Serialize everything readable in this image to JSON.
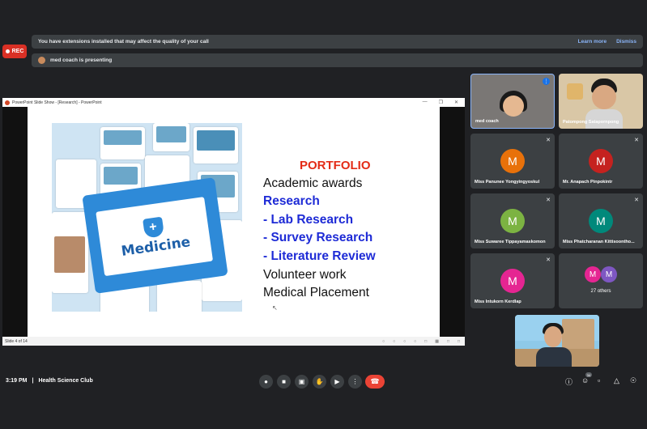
{
  "rec_label": "REC",
  "banner_extensions": {
    "text": "You have extensions installed that may affect the quality of your call",
    "learn_more": "Learn more",
    "dismiss": "Dismiss"
  },
  "banner_presenting": {
    "text": "med coach is presenting"
  },
  "ppt": {
    "title": "PowerPoint Slide Show - [Research] - PowerPoint",
    "status": "Slide 4 of 14",
    "slide": {
      "heading": "PORTFOLIO",
      "lines": [
        {
          "text": "Academic awards",
          "style": "black"
        },
        {
          "text": "Research",
          "style": "blue"
        },
        {
          "text": "-   Lab Research",
          "style": "blue"
        },
        {
          "text": "-   Survey Research",
          "style": "blue"
        },
        {
          "text": "-   Literature Review",
          "style": "blue"
        },
        {
          "text": "Volunteer work",
          "style": "black"
        },
        {
          "text": "Medical Placement",
          "style": "black"
        }
      ],
      "image_word": "Medicine"
    }
  },
  "participants": [
    {
      "name": "med coach",
      "type": "video"
    },
    {
      "name": "Patompong Satapornpong",
      "type": "video"
    },
    {
      "name": "Miss Panunee Yongyingyoskul",
      "initial": "M",
      "color": "#e8710a"
    },
    {
      "name": "Mr. Anapach Pinpokintr",
      "initial": "M",
      "color": "#c5221f"
    },
    {
      "name": "Miss Suwaree Tippayamaskomon",
      "initial": "M",
      "color": "#7cb342"
    },
    {
      "name": "Miss Phatcharanan Kittisoontho...",
      "initial": "M",
      "color": "#00897b"
    },
    {
      "name": "Miss Intukorn Kerdlap",
      "initial": "M",
      "color": "#e52592"
    },
    {
      "name": "27 others",
      "initial": "M",
      "color": "#e52592",
      "color2": "#7e57c2"
    }
  ],
  "bottom": {
    "time": "3:19 PM",
    "separator": "|",
    "meeting": "Health Science Club",
    "people_count": "34"
  }
}
